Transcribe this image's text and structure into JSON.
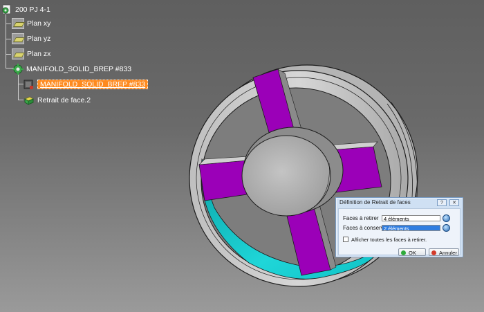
{
  "tree": {
    "root": "200 PJ 4-1",
    "planes": [
      "Plan xy",
      "Plan yz",
      "Plan zx"
    ],
    "solid": "MANIFOLD_SOLID_BREP #833",
    "body": "MANIFOLD_SOLID_BREP #833",
    "feature": "Retrait de face.2"
  },
  "dialog": {
    "title": "Définition de Retrait de faces",
    "help_label": "?",
    "close_label": "✕",
    "faces_remove_label": "Faces à retirer",
    "faces_remove_value": "4 éléments",
    "faces_keep_label": "Faces à conserver",
    "faces_keep_value": "2 éléments",
    "show_all_label": "Afficher toutes les faces à retirer.",
    "show_all_checked": false,
    "ok_label": "OK",
    "cancel_label": "Annuler"
  },
  "colors": {
    "highlight_faces": "#9b00b8",
    "kept_faces": "#19cfd2",
    "solid_gray": "#c8c8c8",
    "selection": "#ff8a1e"
  },
  "icons": {
    "root": "part-root-icon",
    "plane": "plane-icon",
    "solid": "solid-gear-icon",
    "body": "body-icon",
    "feature": "face-removal-icon",
    "pick": "selection-picker-icon",
    "ok": "ok-green-dot-icon",
    "cancel": "cancel-red-dot-icon"
  }
}
